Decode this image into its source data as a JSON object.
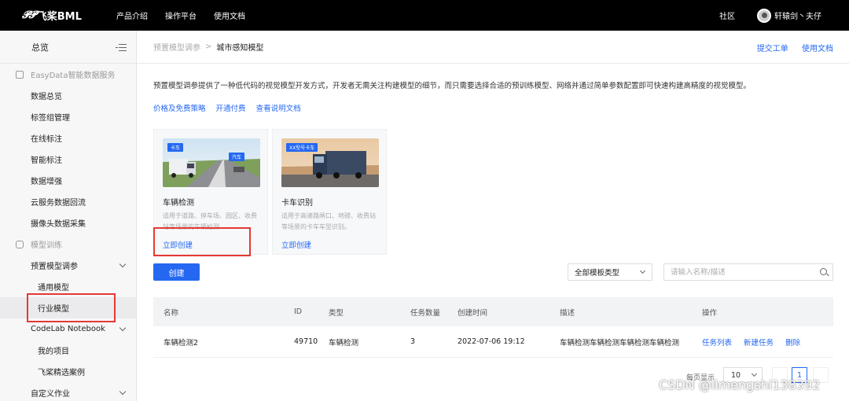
{
  "topnav": {
    "logo": "飞桨BML",
    "logo_mark": "P",
    "items": [
      "产品介绍",
      "操作平台",
      "使用文档"
    ],
    "community": "社区",
    "user": "轩辕剑丶夫仔"
  },
  "sidebar": {
    "overview": "总览",
    "section_data": "EasyData智能数据服务",
    "data_items": [
      "数据总览",
      "标签组管理",
      "在线标注",
      "智能标注",
      "数据增强",
      "云服务数据回流",
      "摄像头数据采集"
    ],
    "section_train": "模型训练",
    "preset": "预置模型调参",
    "preset_sub": [
      "通用模型",
      "行业模型"
    ],
    "codelab": "CodeLab Notebook",
    "codelab_sub": [
      "我的项目",
      "飞桨精选案例"
    ],
    "custom": "自定义作业"
  },
  "breadcrumb": {
    "prev": "预置模型调参",
    "sep": ">",
    "current": "城市感知模型",
    "links": [
      "提交工单",
      "使用文档"
    ]
  },
  "main": {
    "description": "预置模型调参提供了一种低代码的视觉模型开发方式，开发者无需关注构建模型的细节，而只需要选择合适的预训练模型、网络并通过简单参数配置即可快速构建高精度的视觉模型。",
    "links": [
      "价格及免费策略",
      "开通付费",
      "查看说明文档"
    ],
    "cards": [
      {
        "tags": [
          "卡车",
          "汽车"
        ],
        "title": "车辆检测",
        "text": "适用于道路、停车场、园区、收费站等场景的车辆检测",
        "button": "立即创建"
      },
      {
        "tags": [
          "XX型号卡车"
        ],
        "title": "卡车识别",
        "text": "适用于高速路闸口、地磅、收费站等场景的卡车车型识别。",
        "button": "立即创建"
      }
    ],
    "create_button": "创建",
    "filter_select": "全部模板类型",
    "search_placeholder": "请输入名称/描述"
  },
  "table": {
    "headers": [
      "名称",
      "ID",
      "类型",
      "任务数量",
      "创建时间",
      "描述",
      "操作"
    ],
    "rows": [
      {
        "name": "车辆检测2",
        "id": "49710",
        "type": "车辆检测",
        "count": "3",
        "created": "2022-07-06 19:12",
        "desc": "车辆检测车辆检测车辆检测车辆检测",
        "ops": [
          "任务列表",
          "新建任务",
          "删除"
        ]
      }
    ]
  },
  "pagination": {
    "per_page_label": "每页显示",
    "page_size": "10",
    "current_page": "1"
  },
  "watermark": "CSDN @limengshi138392",
  "colors": {
    "accent": "#2468f2",
    "highlight": "#e53935"
  }
}
